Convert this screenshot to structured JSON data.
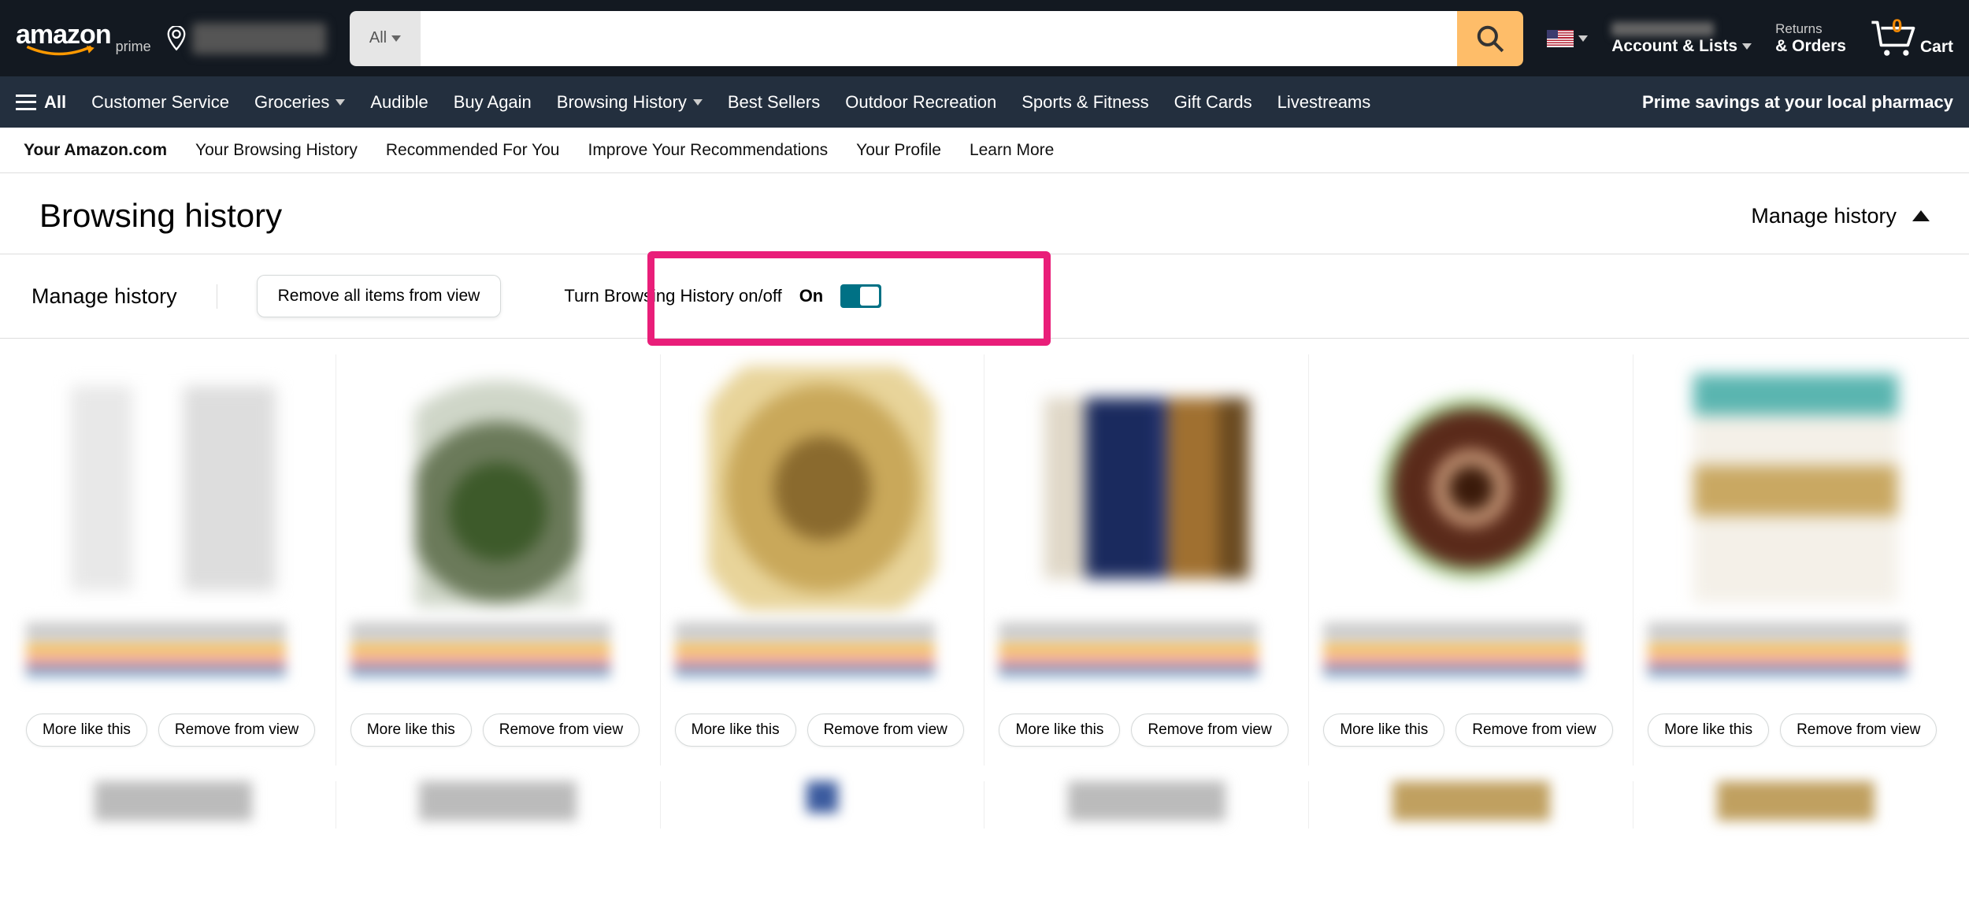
{
  "header": {
    "search_dept": "All",
    "search_placeholder": "",
    "account_label": "Account & Lists",
    "returns_top": "Returns",
    "returns_main": "& Orders",
    "cart_count": "0",
    "cart_label": "Cart"
  },
  "nav_sub": {
    "all": "All",
    "items": [
      "Customer Service",
      "Groceries",
      "Audible",
      "Buy Again",
      "Browsing History",
      "Best Sellers",
      "Outdoor Recreation",
      "Sports & Fitness",
      "Gift Cards",
      "Livestreams"
    ],
    "promo": "Prime savings at your local pharmacy"
  },
  "tabs": {
    "items": [
      "Your Amazon.com",
      "Your Browsing History",
      "Recommended For You",
      "Improve Your Recommendations",
      "Your Profile",
      "Learn More"
    ],
    "active": 0
  },
  "page": {
    "title": "Browsing history",
    "manage_link": "Manage history",
    "manage_heading": "Manage history",
    "remove_all": "Remove all items from view",
    "toggle_label": "Turn Browsing History on/off",
    "toggle_state": "On"
  },
  "card_actions": {
    "more": "More like this",
    "remove": "Remove from view"
  }
}
